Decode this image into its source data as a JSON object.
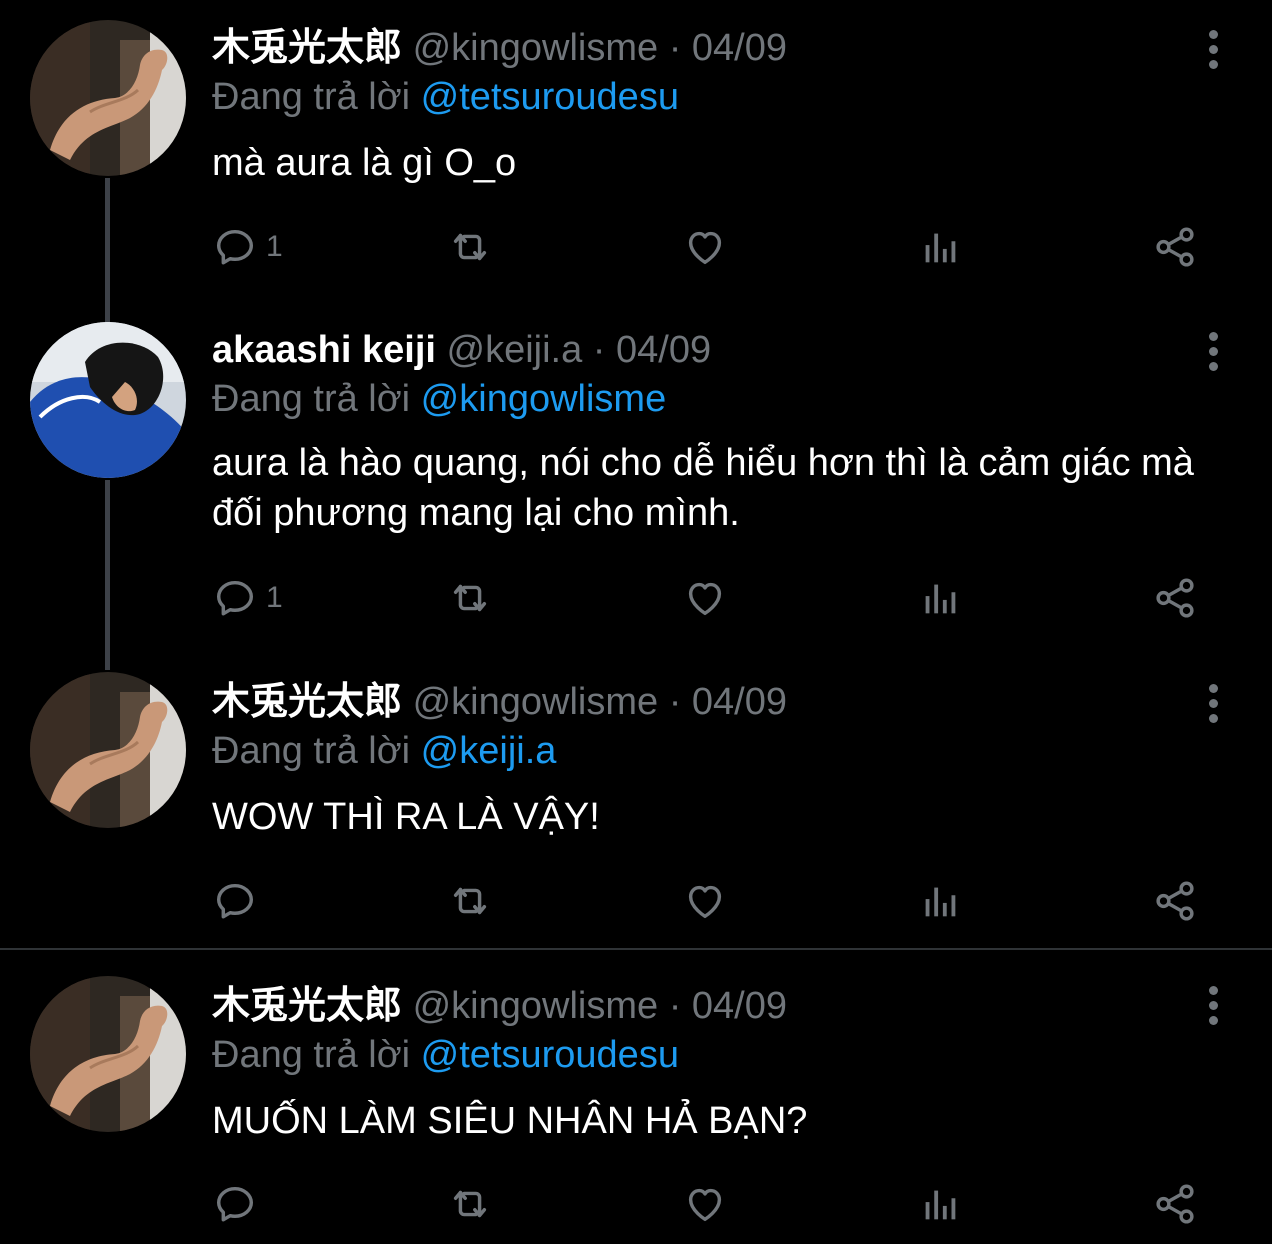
{
  "colors": {
    "background": "#000000",
    "name": "#ffffff",
    "muted": "#71767b",
    "link": "#1d9bf0"
  },
  "tweets": [
    {
      "name": "木兎光太郎",
      "handle": "@kingowlisme",
      "date": "04/09",
      "reply_prefix": "Đang trả lời",
      "reply_to": "@tetsuroudesu",
      "text": "mà aura là gì O_o",
      "reply_count": "1",
      "avatar": "flexing-arm"
    },
    {
      "name": "akaashi keiji",
      "handle": "@keiji.a",
      "date": "04/09",
      "reply_prefix": "Đang trả lời",
      "reply_to": "@kingowlisme",
      "text": "aura là hào quang, nói cho dễ hiểu hơn thì là cảm giác mà đối phương mang lại cho mình.",
      "reply_count": "1",
      "avatar": "person-blue-shirt"
    },
    {
      "name": "木兎光太郎",
      "handle": "@kingowlisme",
      "date": "04/09",
      "reply_prefix": "Đang trả lời",
      "reply_to": "@keiji.a",
      "text": "WOW THÌ RA LÀ VẬY!",
      "reply_count": "",
      "avatar": "flexing-arm"
    },
    {
      "name": "木兎光太郎",
      "handle": "@kingowlisme",
      "date": "04/09",
      "reply_prefix": "Đang trả lời",
      "reply_to": "@tetsuroudesu",
      "text": "MUỐN LÀM SIÊU NHÂN HẢ BẠN?",
      "reply_count": "",
      "avatar": "flexing-arm"
    }
  ],
  "separator": "·",
  "icons": [
    "reply-icon",
    "retweet-icon",
    "like-icon",
    "views-icon",
    "share-icon",
    "more-options-icon"
  ]
}
